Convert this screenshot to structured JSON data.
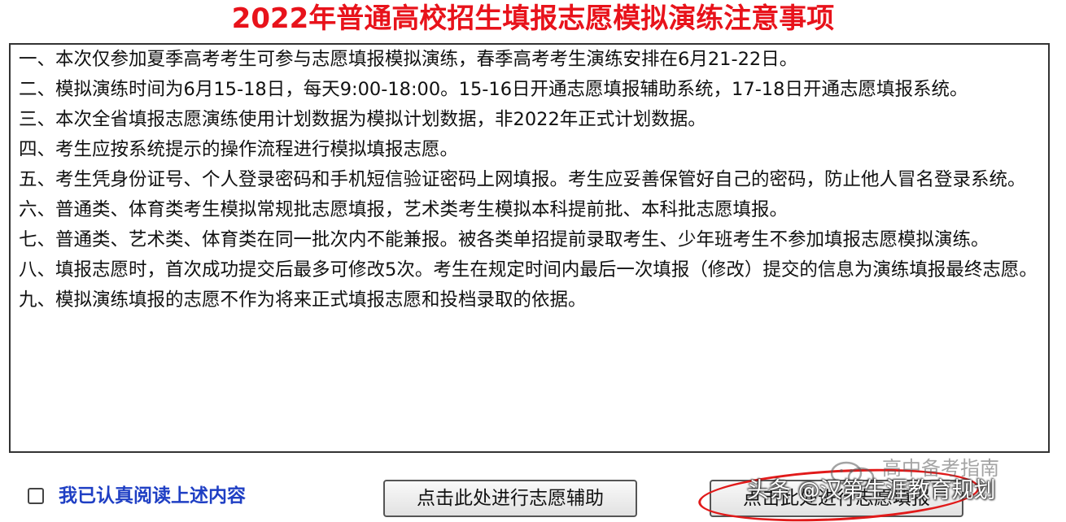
{
  "title": "2022年普通高校招生填报志愿模拟演练注意事项",
  "notices": [
    "一、本次仅参加夏季高考考生可参与志愿填报模拟演练，春季高考考生演练安排在6月21-22日。",
    "二、模拟演练时间为6月15-18日，每天9:00-18:00。15-16日开通志愿填报辅助系统，17-18日开通志愿填报系统。",
    "三、本次全省填报志愿演练使用计划数据为模拟计划数据，非2022年正式计划数据。",
    "四、考生应按系统提示的操作流程进行模拟填报志愿。",
    "五、考生凭身份证号、个人登录密码和手机短信验证密码上网填报。考生应妥善保管好自己的密码，防止他人冒名登录系统。",
    "六、普通类、体育类考生模拟常规批志愿填报，艺术类考生模拟本科提前批、本科批志愿填报。",
    "七、普通类、艺术类、体育类在同一批次内不能兼报。被各类单招提前录取考生、少年班考生不参加填报志愿模拟演练。",
    "八、填报志愿时，首次成功提交后最多可修改5次。考生在规定时间内最后一次填报（修改）提交的信息为演练填报最终志愿。",
    "九、模拟演练填报的志愿不作为将来正式填报志愿和投档录取的依据。"
  ],
  "footer": {
    "checkbox_label": "我已认真阅读上述内容",
    "checkbox_checked": false,
    "assist_button": "点击此处进行志愿辅助",
    "fill_button": "点击此处进行志愿填报"
  },
  "watermark": {
    "top": "高中备考指南",
    "bottom": "头条 @汉第生涯教育规划",
    "icon": "wechat-icon"
  },
  "colors": {
    "title": "#e8131b",
    "checkbox_label": "#1f3fc4",
    "highlight_circle": "#e11a1a"
  }
}
